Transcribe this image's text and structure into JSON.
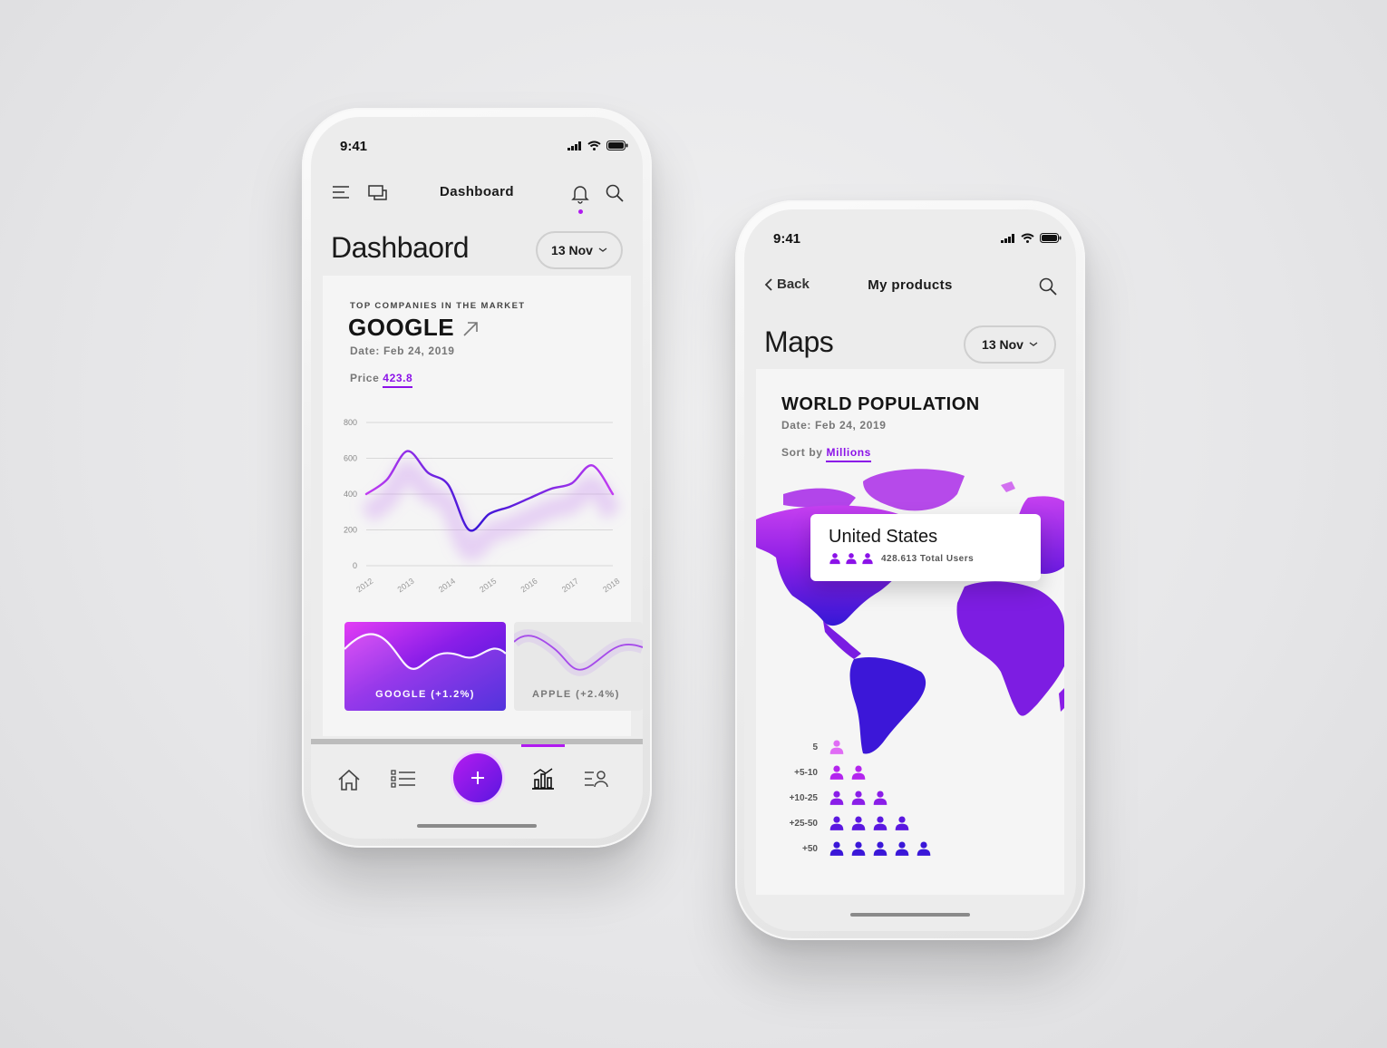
{
  "status": {
    "time": "9:41"
  },
  "dashboard": {
    "nav_title": "Dashboard",
    "title": "Dashbaord",
    "date_pill": "13 Nov",
    "card": {
      "eyebrow": "TOP COMPANIES IN THE MARKET",
      "company": "GOOGLE",
      "date_label": "Date: Feb 24, 2019",
      "price_label": "Price",
      "price_value": "423.8"
    },
    "mini_cards": [
      {
        "label": "GOOGLE (+1.2%)"
      },
      {
        "label": "APPLE  (+2.4%)"
      }
    ],
    "tabs": [
      "home",
      "list",
      "add",
      "chart",
      "profile"
    ],
    "active_tab": "chart"
  },
  "chart_data": {
    "type": "line",
    "x": [
      2012,
      2012.5,
      2013,
      2013.5,
      2014,
      2014.5,
      2015,
      2015.5,
      2016,
      2016.5,
      2017,
      2017.5,
      2018
    ],
    "series": [
      {
        "values": [
          400,
          480,
          640,
          520,
          450,
          200,
          290,
          330,
          380,
          430,
          460,
          560,
          400
        ]
      }
    ],
    "x_ticks": [
      "2012",
      "2013",
      "2014",
      "2015",
      "2016",
      "2017",
      "2018"
    ],
    "y_ticks": [
      "0",
      "200",
      "400",
      "600",
      "800"
    ],
    "ylim": [
      0,
      800
    ],
    "grid": true
  },
  "maps": {
    "back_label": "Back",
    "nav_title": "My products",
    "title": "Maps",
    "date_pill": "13 Nov",
    "card": {
      "title": "WORLD POPULATION",
      "date_label": "Date: Feb 24, 2019",
      "sort_label": "Sort by",
      "sort_value": "Millions"
    },
    "tooltip": {
      "country": "United States",
      "stat": "428.613 Total Users",
      "people_icons": 3
    },
    "legend": [
      {
        "label": "5",
        "count": 1
      },
      {
        "label": "+5-10",
        "count": 2
      },
      {
        "label": "+10-25",
        "count": 3
      },
      {
        "label": "+25-50",
        "count": 4
      },
      {
        "label": "+50",
        "count": 5
      }
    ]
  },
  "colors": {
    "accent": "#8b12e8",
    "deep": "#3a14d6",
    "pink": "#e040fb"
  }
}
